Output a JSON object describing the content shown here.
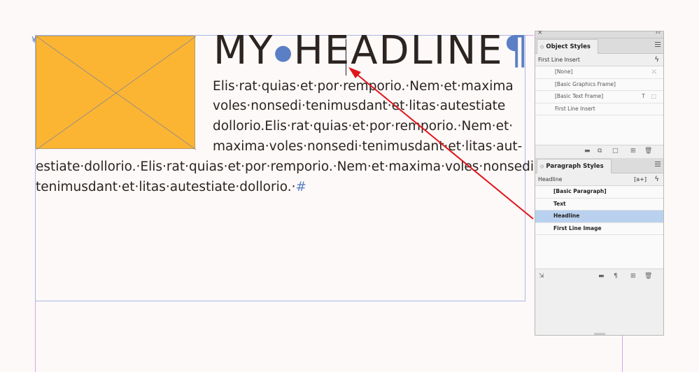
{
  "document": {
    "headline": {
      "word1": "MY",
      "word2": "HEADLINE",
      "pilcrow": "¶"
    },
    "body_lines": [
      "Elis·rat·quias·et·por·remporio.·Nem·et·maxima",
      "voles·nonsedi·tenimusdant·et·litas·autestiate",
      "dollorio.Elis·rat·quias·et·por·remporio.·Nem·et·",
      "maxima·voles·nonsedi·tenimusdant·et·litas·aut-",
      "estiate·dollorio.·Elis·rat·quias·et·por·remporio.·Nem·et·maxima·voles·nonsedi·",
      "tenimusdant·et·litas·autestiate·dollorio.·"
    ],
    "end_mark": "#",
    "anchor_mark": "¥"
  },
  "colors": {
    "image_fill": "#fcb532",
    "accent": "#5b7fc4",
    "arrow": "#e0141b",
    "selected": "#b9d1ef"
  },
  "object_styles": {
    "title": "Object Styles",
    "current": "First Line Insert",
    "current_icon": "lightning-icon",
    "items": [
      "[None]",
      "[Basic Graphics Frame]",
      "[Basic Text Frame]",
      "First Line Insert"
    ]
  },
  "paragraph_styles": {
    "title": "Paragraph Styles",
    "current": "Headline",
    "new_style_glyph": "[a+]",
    "items": [
      "[Basic Paragraph]",
      "Text",
      "Headline",
      "First Line Image"
    ],
    "selected_index": 2
  }
}
